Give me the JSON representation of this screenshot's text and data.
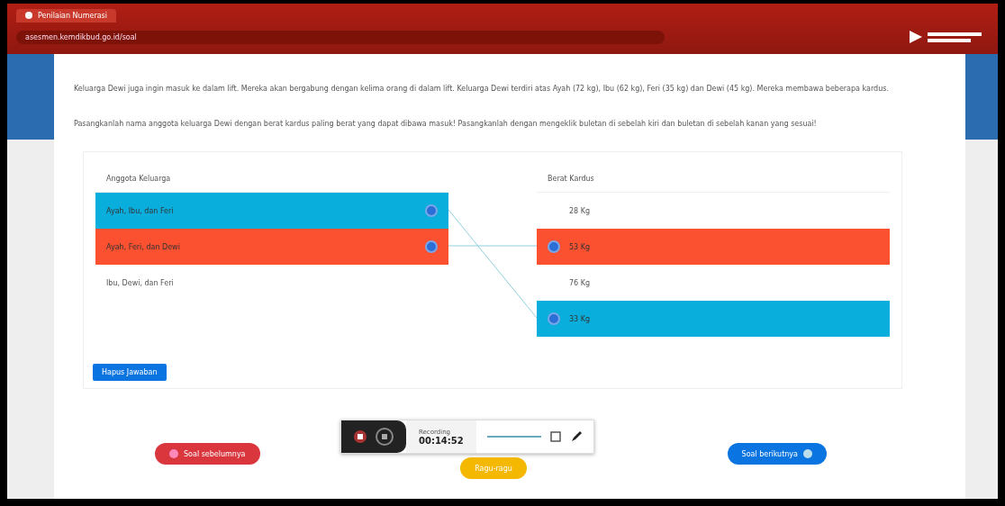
{
  "browser": {
    "tab_title": "Penilaian Numerasi",
    "url": "asesmen.kemdikbud.go.id/soal"
  },
  "question": {
    "paragraphs": [
      "Keluarga Dewi juga ingin masuk ke dalam lift. Mereka akan bergabung dengan kelima orang di dalam lift. Keluarga Dewi terdiri atas Ayah (72 kg), Ibu (62 kg), Feri (35 kg) dan Dewi (45 kg). Mereka membawa beberapa kardus.",
      "Pasangkanlah nama anggota keluarga Dewi dengan berat kardus paling berat yang dapat dibawa masuk! Pasangkanlah dengan mengeklik buletan di sebelah kiri dan buletan di sebelah kanan yang sesuai!"
    ]
  },
  "matching": {
    "left_header": "Anggota Keluarga",
    "right_header": "Berat Kardus",
    "left": [
      {
        "label": "Ayah, Ibu, dan Feri",
        "selected": true,
        "color": "#0aaedc"
      },
      {
        "label": "Ayah, Feri, dan Dewi",
        "selected": true,
        "color": "#fc5130"
      },
      {
        "label": "Ibu, Dewi, dan Feri",
        "selected": false
      }
    ],
    "right": [
      {
        "label": "28 Kg",
        "selected": false
      },
      {
        "label": "53 Kg",
        "selected": true,
        "color": "#fc5130"
      },
      {
        "label": "76 Kg",
        "selected": false
      },
      {
        "label": "33 Kg",
        "selected": true,
        "color": "#0aaedc"
      }
    ],
    "reset_button": "Hapus Jawaban"
  },
  "nav": {
    "prev": "Soal sebelumnya",
    "doubt": "Ragu-ragu",
    "next": "Soal berikutnya"
  },
  "recorder": {
    "label": "Recording",
    "time": "00:14:52"
  }
}
